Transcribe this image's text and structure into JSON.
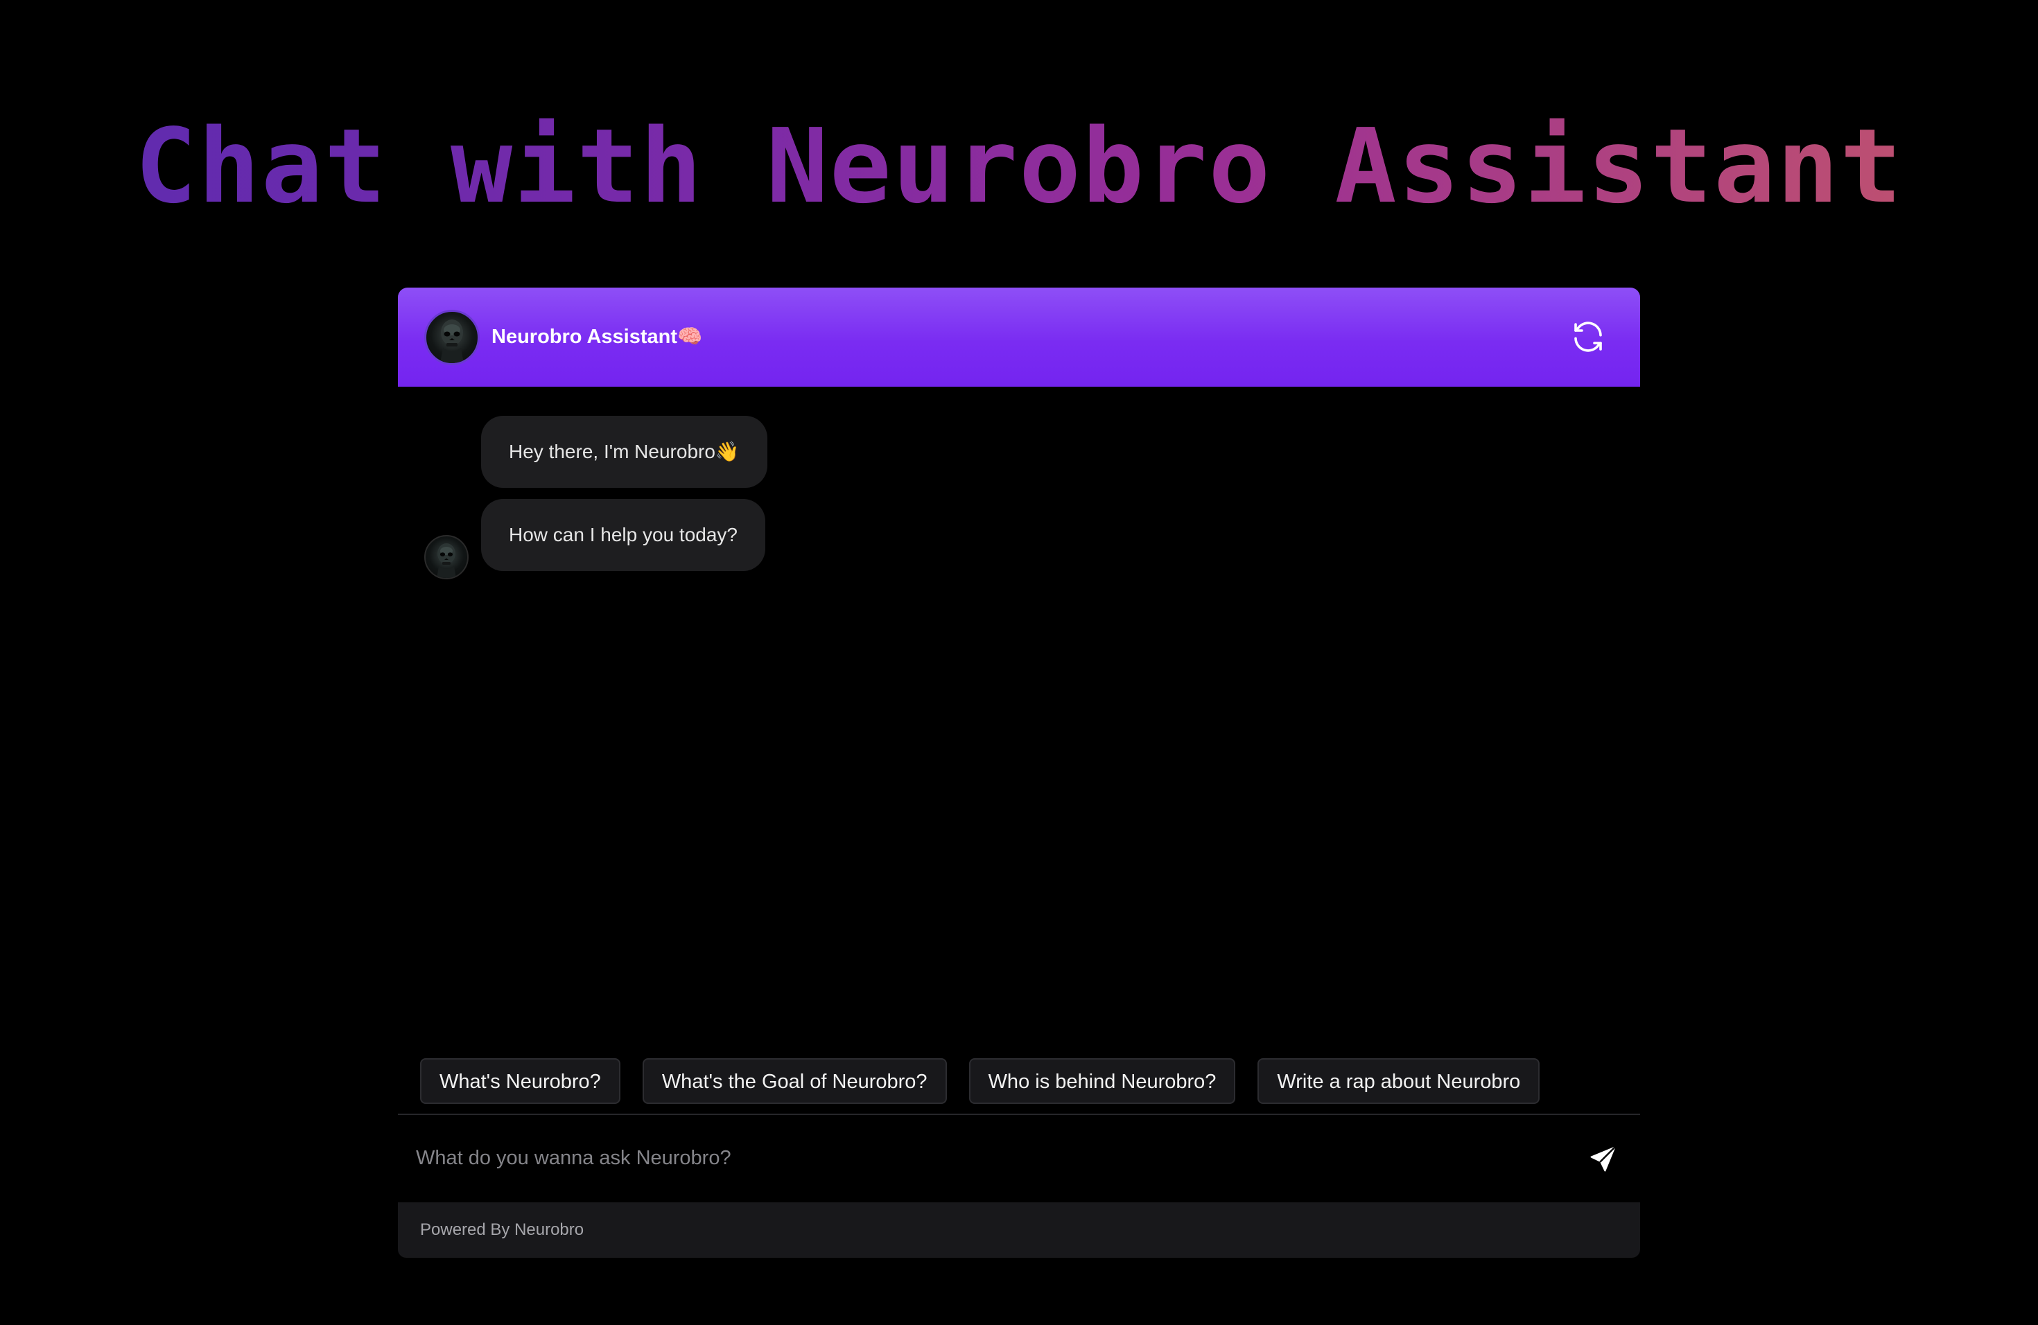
{
  "page": {
    "title": "Chat with Neurobro Assistant"
  },
  "header": {
    "title": "Neurobro Assistant🧠",
    "avatar_icon": "skull-avatar-icon",
    "refresh_icon": "refresh-icon"
  },
  "messages": [
    {
      "sender": "assistant",
      "text": "Hey there, I'm Neurobro👋"
    },
    {
      "sender": "assistant",
      "text": "How can I help you today?"
    }
  ],
  "suggestions": [
    "What's Neurobro?",
    "What's the Goal of Neurobro?",
    "Who is behind Neurobro?",
    "Write a rap about Neurobro"
  ],
  "input": {
    "placeholder": "What do you wanna ask Neurobro?",
    "value": "",
    "send_icon": "send-icon"
  },
  "footer": {
    "text": "Powered By Neurobro"
  },
  "colors": {
    "header_gradient_top": "#8e4ff6",
    "header_gradient_bottom": "#7424f0",
    "title_gradient_start": "#5b2bb0",
    "title_gradient_end": "#c4566a",
    "bubble_bg": "#1e1e20",
    "chip_bg": "#18181b",
    "page_bg": "#000000"
  }
}
